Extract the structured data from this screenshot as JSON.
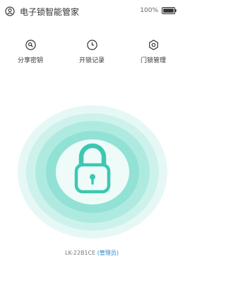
{
  "header": {
    "title": "电子锁智能管家",
    "battery": "100%"
  },
  "actions": [
    {
      "label": "分享密钥",
      "icon": "search-key-icon"
    },
    {
      "label": "开锁记录",
      "icon": "clock-icon"
    },
    {
      "label": "门锁管理",
      "icon": "gear-icon"
    }
  ],
  "lock": {
    "icon": "padlock-icon",
    "accent": "#3dc7b3"
  },
  "device": {
    "id": "LK-22B1CE",
    "role": "(管理员)"
  }
}
